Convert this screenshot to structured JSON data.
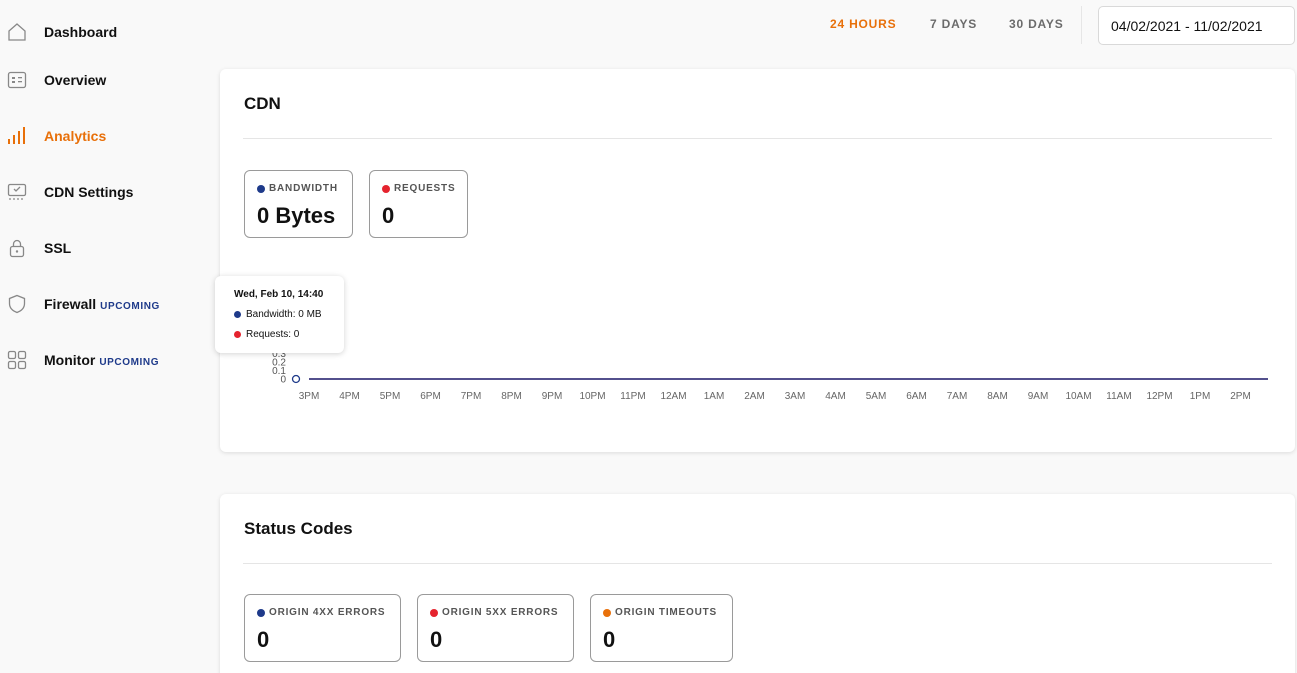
{
  "sidebar": {
    "items": [
      {
        "label": "Dashboard",
        "icon": "home-icon",
        "active": false
      },
      {
        "label": "Overview",
        "icon": "overview-icon",
        "active": false
      },
      {
        "label": "Analytics",
        "icon": "analytics-bars-icon",
        "active": true
      },
      {
        "label": "CDN Settings",
        "icon": "cdn-settings-icon",
        "active": false
      },
      {
        "label": "SSL",
        "icon": "lock-icon",
        "active": false
      },
      {
        "label": "Firewall",
        "icon": "shield-icon",
        "active": false,
        "badge": "UPCOMING"
      },
      {
        "label": "Monitor",
        "icon": "grid-icon",
        "active": false,
        "badge": "UPCOMING"
      }
    ]
  },
  "header": {
    "ranges": [
      "24 HOURS",
      "7 DAYS",
      "30 DAYS"
    ],
    "active_range": "24 HOURS",
    "date_range": "04/02/2021 - 11/02/2021"
  },
  "cdn": {
    "title": "CDN",
    "stats": [
      {
        "label": "BANDWIDTH",
        "value": "0 Bytes",
        "color": "#1e3a8a"
      },
      {
        "label": "REQUESTS",
        "value": "0",
        "color": "#e5232e"
      }
    ],
    "tooltip": {
      "title": "Wed, Feb 10, 14:40",
      "bandwidth": "Bandwidth: 0 MB",
      "requests": "Requests: 0"
    }
  },
  "chart_data": {
    "type": "line",
    "x": [
      "3PM",
      "4PM",
      "5PM",
      "6PM",
      "7PM",
      "8PM",
      "9PM",
      "10PM",
      "11PM",
      "12AM",
      "1AM",
      "2AM",
      "3AM",
      "4AM",
      "5AM",
      "6AM",
      "7AM",
      "8AM",
      "9AM",
      "10AM",
      "11AM",
      "12PM",
      "1PM",
      "2PM"
    ],
    "y_ticks": [
      "0.3",
      "0.2",
      "0.1",
      "0"
    ],
    "series": [
      {
        "name": "Bandwidth",
        "color": "#1e3a8a",
        "values": [
          0,
          0,
          0,
          0,
          0,
          0,
          0,
          0,
          0,
          0,
          0,
          0,
          0,
          0,
          0,
          0,
          0,
          0,
          0,
          0,
          0,
          0,
          0,
          0
        ]
      },
      {
        "name": "Requests",
        "color": "#e5232e",
        "values": [
          0,
          0,
          0,
          0,
          0,
          0,
          0,
          0,
          0,
          0,
          0,
          0,
          0,
          0,
          0,
          0,
          0,
          0,
          0,
          0,
          0,
          0,
          0,
          0
        ]
      }
    ]
  },
  "status_codes": {
    "title": "Status Codes",
    "stats": [
      {
        "label": "ORIGIN 4XX ERRORS",
        "value": "0",
        "color": "#1e3a8a"
      },
      {
        "label": "ORIGIN 5XX ERRORS",
        "value": "0",
        "color": "#e5232e"
      },
      {
        "label": "ORIGIN TIMEOUTS",
        "value": "0",
        "color": "#e8700a"
      }
    ]
  },
  "colors": {
    "accent": "#e8700a",
    "badge": "#1e3a8a"
  }
}
